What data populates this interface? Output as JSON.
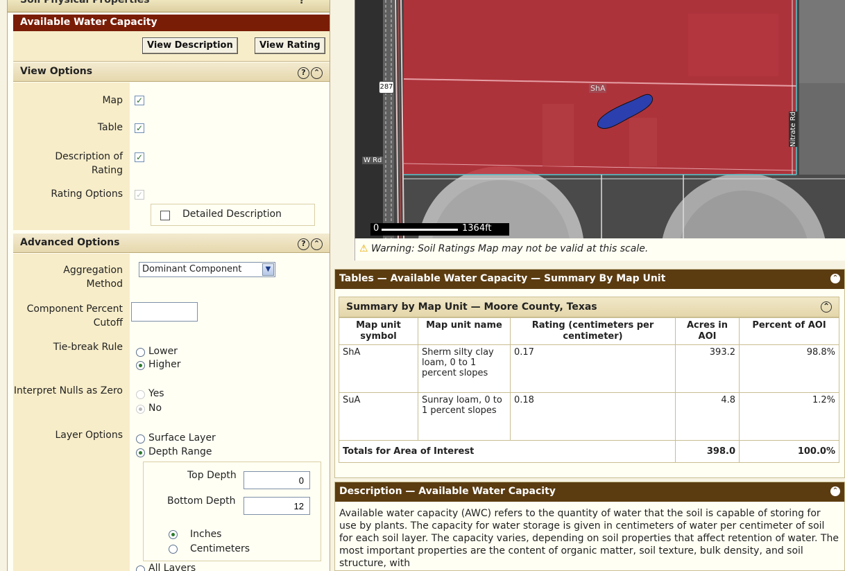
{
  "top_section": {
    "title": "Soil Physical Properties"
  },
  "rating_header": "Available Water Capacity",
  "buttons": {
    "view_description": "View Description",
    "view_rating": "View Rating"
  },
  "view_options": {
    "title": "View Options",
    "map": "Map",
    "table": "Table",
    "description": "Description of Rating",
    "rating_options": "Rating Options",
    "detailed_description": "Detailed Description"
  },
  "advanced_options": {
    "title": "Advanced Options",
    "aggregation_label": "Aggregation Method",
    "aggregation_value": "Dominant Component",
    "component_cutoff_label": "Component Percent Cutoff",
    "component_cutoff_value": "",
    "tiebreak_label": "Tie-break Rule",
    "tiebreak_lower": "Lower",
    "tiebreak_higher": "Higher",
    "nulls_label": "Interpret Nulls as Zero",
    "nulls_yes": "Yes",
    "nulls_no": "No",
    "layer_label": "Layer Options",
    "layer_surface": "Surface Layer",
    "layer_depth": "Depth Range",
    "top_depth_label": "Top Depth",
    "top_depth_value": "0",
    "bottom_depth_label": "Bottom Depth",
    "bottom_depth_value": "12",
    "unit_inches": "Inches",
    "unit_cm": "Centimeters",
    "layer_all": "All Layers"
  },
  "map": {
    "highway": "287",
    "road_w": "W Rd",
    "road_nitrate": "Nitrate Rd",
    "unit_label": "ShA",
    "scale_start": "0",
    "scale_end": "1364ft",
    "colors": {
      "rating_red": "#c0303a",
      "rating_blue": "#2c3fae"
    }
  },
  "warning": "Warning: Soil Ratings Map may not be valid at this scale.",
  "tables": {
    "bar_title": "Tables — Available Water Capacity — Summary By Map Unit",
    "sub_title": "Summary by Map Unit — Moore County, Texas",
    "headers": [
      "Map unit symbol",
      "Map unit name",
      "Rating (centimeters per centimeter)",
      "Acres in AOI",
      "Percent of AOI"
    ],
    "rows": [
      [
        "ShA",
        "Sherm silty clay loam, 0 to 1 percent slopes",
        "0.17",
        "393.2",
        "98.8%"
      ],
      [
        "SuA",
        "Sunray loam, 0 to 1 percent slopes",
        "0.18",
        "4.8",
        "1.2%"
      ]
    ],
    "total": {
      "label": "Totals for Area of Interest",
      "acres": "398.0",
      "percent": "100.0%"
    }
  },
  "description": {
    "bar_title": "Description — Available Water Capacity",
    "text": "Available water capacity (AWC) refers to the quantity of water that the soil is capable of storing for use by plants. The capacity for water storage is given in centimeters of water per centimeter of soil for each soil layer. The capacity varies, depending on soil properties that affect retention of water. The most important properties are the content of organic matter, soil texture, bulk density, and soil structure, with"
  }
}
